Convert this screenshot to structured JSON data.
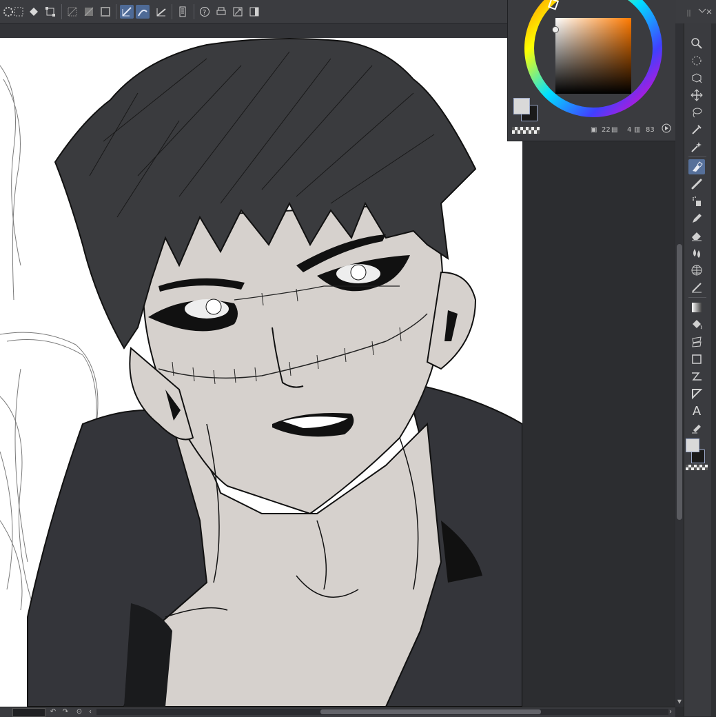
{
  "color_panel": {
    "value_a": "22",
    "value_b": "4",
    "value_c": "83",
    "colors": {
      "hue_selected": "#ff6a00",
      "main_color": "#d9d9d9",
      "sub_color": "#1a1a1a"
    }
  },
  "toolbar": {
    "icons": [
      "spinner-icon",
      "marquee-icon",
      "fill-icon",
      "transform-icon",
      "selection-off-icon",
      "selection-invert-icon",
      "selection-border-icon",
      "snap-ruler-icon",
      "snap-special-ruler-icon",
      "snap-grid-icon",
      "ruler-toggle-icon",
      "help-icon",
      "print-icon",
      "fit-icon",
      "panel-icon"
    ]
  },
  "toolbox": {
    "icons": [
      "zoom-icon",
      "rotate-icon",
      "camera-icon",
      "move-icon",
      "lasso-icon",
      "eyedropper-icon",
      "magic-wand-icon",
      "pen-tool-icon",
      "brush-icon",
      "airbrush-icon",
      "pencil-icon",
      "eraser-icon",
      "blend-icon",
      "grid-icon",
      "ruler-tool-icon",
      "gradient-icon",
      "fill-bucket-icon",
      "figure-icon",
      "rectangle-icon",
      "polyline-icon",
      "frame-icon",
      "text-icon",
      "correction-icon"
    ],
    "text_tool_glyph": "A"
  },
  "canvas": {
    "colors": {
      "skin": "#d6d1cd",
      "hair": "#3a3b3e",
      "jacket": "#34353a",
      "line": "#111111"
    }
  }
}
